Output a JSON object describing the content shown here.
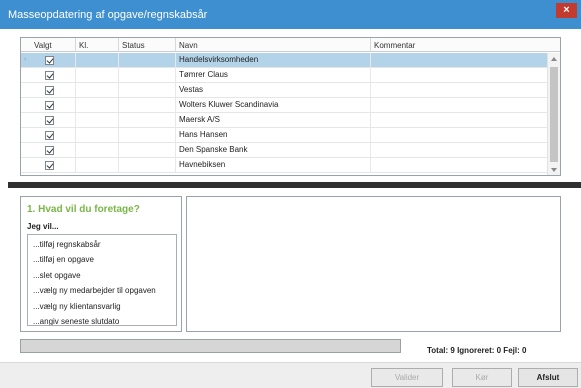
{
  "window": {
    "title": "Masseopdatering af opgave/regnskabsår",
    "close_glyph": "×"
  },
  "grid": {
    "columns": [
      "Valgt",
      "Kl.",
      "Status",
      "Navn",
      "Kommentar"
    ],
    "selected_row_index": 0,
    "rows": [
      {
        "checked": true,
        "kl": "",
        "status": "",
        "navn": "Handelsvirksomheden",
        "kommentar": ""
      },
      {
        "checked": true,
        "kl": "",
        "status": "",
        "navn": "Tømrer Claus",
        "kommentar": ""
      },
      {
        "checked": true,
        "kl": "",
        "status": "",
        "navn": "Vestas",
        "kommentar": ""
      },
      {
        "checked": true,
        "kl": "",
        "status": "",
        "navn": "Wolters Kluwer Scandinavia",
        "kommentar": ""
      },
      {
        "checked": true,
        "kl": "",
        "status": "",
        "navn": "Maersk A/S",
        "kommentar": ""
      },
      {
        "checked": true,
        "kl": "",
        "status": "",
        "navn": "Hans Hansen",
        "kommentar": ""
      },
      {
        "checked": true,
        "kl": "",
        "status": "",
        "navn": "Den Spanske Bank",
        "kommentar": ""
      },
      {
        "checked": true,
        "kl": "",
        "status": "",
        "navn": "Havnebiksen",
        "kommentar": ""
      }
    ],
    "row_marker_glyph": "›"
  },
  "actions": {
    "title": "1. Hvad vil du foretage?",
    "subtitle": "Jeg vil...",
    "items": [
      "...tilføj regnskabsår",
      "...tilføj en opgave",
      "...slet opgave",
      "...vælg ny medarbejder til opgaven",
      "...vælg ny klientansvarlig",
      "...angiv seneste slutdato"
    ]
  },
  "status": {
    "progress": 0,
    "totals_text": "Total: 9  Ignoreret: 0  Fejl: 0"
  },
  "buttons": {
    "valider": "Valider",
    "koer": "Kør",
    "afslut": "Afslut"
  },
  "colors": {
    "titlebar": "#3d8fd0",
    "close": "#c33a2e",
    "selected_row": "#b3d3e9",
    "action_title": "#7ab648"
  }
}
